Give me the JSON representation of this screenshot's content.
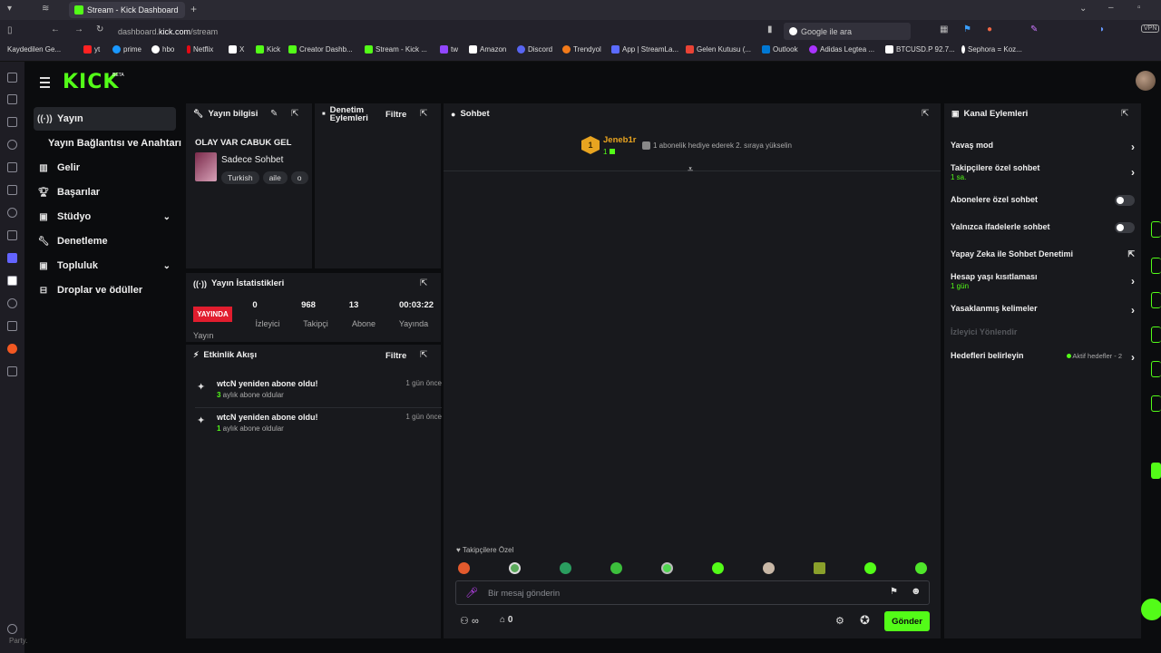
{
  "browser": {
    "tab_title": "Stream - Kick Dashboard",
    "url_prefix": "dashboard.",
    "url_host": "kick.com",
    "url_path": "/stream",
    "search_placeholder": "Google ile ara",
    "vpn_label": "VPN",
    "bookmarks": [
      "Kaydedilen Ge...",
      "yt",
      "prime",
      "hbo",
      "Netflix",
      "X",
      "Kick",
      "Creator Dashb...",
      "Stream - Kick ...",
      "tw",
      "Amazon",
      "Discord",
      "Trendyol",
      "App | StreamLa...",
      "Gelen Kutusu (...",
      "Outlook",
      "Adidas Legtea ...",
      "BTCUSD.P 92.7...",
      "Sephora = Koz..."
    ]
  },
  "app": {
    "logo": "KICK",
    "logo_badge": "BETA"
  },
  "nav": {
    "items": [
      {
        "label": "Yayın"
      },
      {
        "label": "Yayın Bağlantısı ve Anahtarı"
      },
      {
        "label": "Gelir"
      },
      {
        "label": "Başarılar"
      },
      {
        "label": "Stüdyo"
      },
      {
        "label": "Denetleme"
      },
      {
        "label": "Topluluk"
      },
      {
        "label": "Droplar ve ödüller"
      }
    ]
  },
  "stream_info": {
    "title": "Yayın bilgisi",
    "stream_title": "OLAY VAR CABUK GEL",
    "category": "Sadece Sohbet",
    "tags": [
      "Turkish",
      "aile",
      "o"
    ]
  },
  "mod_actions": {
    "title": "Denetim Eylemleri",
    "filter_label": "Filtre"
  },
  "stream_stats": {
    "title": "Yayın İstatistikleri",
    "live_badge": "YAYINDA",
    "stream_label": "Yayın",
    "stats": [
      {
        "value": "0",
        "label": "İzleyici"
      },
      {
        "value": "968",
        "label": "Takipçi"
      },
      {
        "value": "13",
        "label": "Abone"
      },
      {
        "value": "00:03:22",
        "label": "Yayında"
      }
    ]
  },
  "activity": {
    "title": "Etkinlik Akışı",
    "filter_label": "Filtre",
    "items": [
      {
        "title": "wtcN yeniden abone oldu!",
        "count": "3",
        "sub": " aylık abone oldular",
        "time": "1 gün önce"
      },
      {
        "title": "wtcN yeniden abone oldu!",
        "count": "1",
        "sub": " aylık abone oldular",
        "time": "1 gün önce"
      }
    ]
  },
  "chat": {
    "title": "Sohbet",
    "gifter_name": "Jeneb1r",
    "gifter_rank": "1",
    "gifter_count": "1",
    "gift_message": "1 abonelik hediye ederek 2. sıraya yükselin",
    "followers_only_label": "Takipçilere Özel",
    "input_placeholder": "Bir mesaj gönderin",
    "infinity_label": "∞",
    "points_value": "0",
    "send_label": "Gönder"
  },
  "channel_actions": {
    "title": "Kanal Eylemleri",
    "items": [
      {
        "label": "Yavaş mod"
      },
      {
        "label": "Takipçilere özel sohbet",
        "sub": "1 sa."
      },
      {
        "label": "Abonelere özel sohbet"
      },
      {
        "label": "Yalnızca ifadelerle sohbet"
      },
      {
        "label": "Yapay Zeka ile Sohbet Denetimi"
      },
      {
        "label": "Hesap yaşı kısıtlaması",
        "sub": "1 gün"
      },
      {
        "label": "Yasaklanmış kelimeler"
      },
      {
        "label": "İzleyici Yönlendir"
      },
      {
        "label": "Hedefleri belirleyin",
        "status": "Aktif hedefler - 2"
      }
    ]
  },
  "footer_text": "Party.",
  "colors": {
    "accent": "#53fc18",
    "live_red": "#e11d2e",
    "panel_bg": "#18191d",
    "page_bg": "#0b0c0e"
  }
}
